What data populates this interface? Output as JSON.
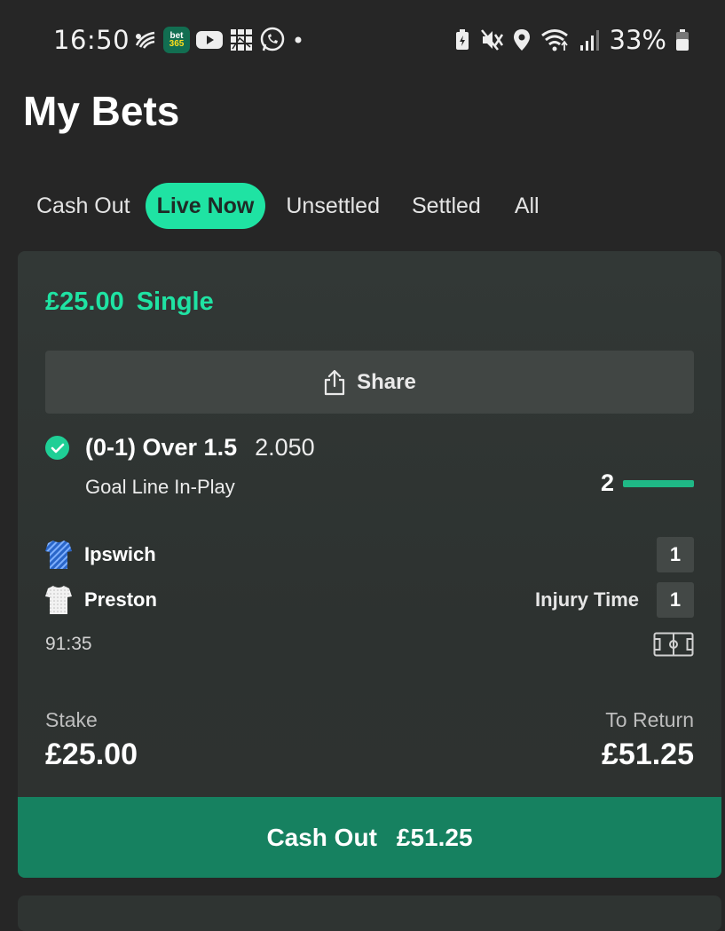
{
  "status_bar": {
    "time": "16:50",
    "battery_percent": "33%",
    "notification_icons": [
      "gallery-cast-icon",
      "bet365-app-icon",
      "youtube-icon",
      "photos-icon",
      "whatsapp-icon",
      "more-dot-icon"
    ],
    "system_icons": [
      "battery-saver-icon",
      "mute-icon",
      "location-icon",
      "wifi-icon",
      "signal-icon",
      "battery-icon"
    ],
    "bet365_badge_top": "bet",
    "bet365_badge_bottom": "365"
  },
  "header": {
    "title": "My Bets"
  },
  "tabs": [
    {
      "label": "Cash Out",
      "active": false
    },
    {
      "label": "Live Now",
      "active": true
    },
    {
      "label": "Unsettled",
      "active": false
    },
    {
      "label": "Settled",
      "active": false
    },
    {
      "label": "All",
      "active": false
    }
  ],
  "bet": {
    "stake_heading": "£25.00",
    "bet_type": "Single",
    "share_label": "Share",
    "selection": "(0-1) Over 1.5",
    "odds": "2.050",
    "market": "Goal Line In-Play",
    "goal_line_count": "2",
    "teams": [
      {
        "name": "Ipswich",
        "score": "1",
        "status": ""
      },
      {
        "name": "Preston",
        "score": "1",
        "status": "Injury Time"
      }
    ],
    "clock": "91:35",
    "stake_label": "Stake",
    "stake_value": "£25.00",
    "return_label": "To Return",
    "return_value": "£51.25",
    "cashout_label": "Cash Out",
    "cashout_value": "£51.25"
  },
  "colors": {
    "accent": "#1fe3a3",
    "cashout": "#168160",
    "background": "#262626",
    "card": "#323836"
  }
}
